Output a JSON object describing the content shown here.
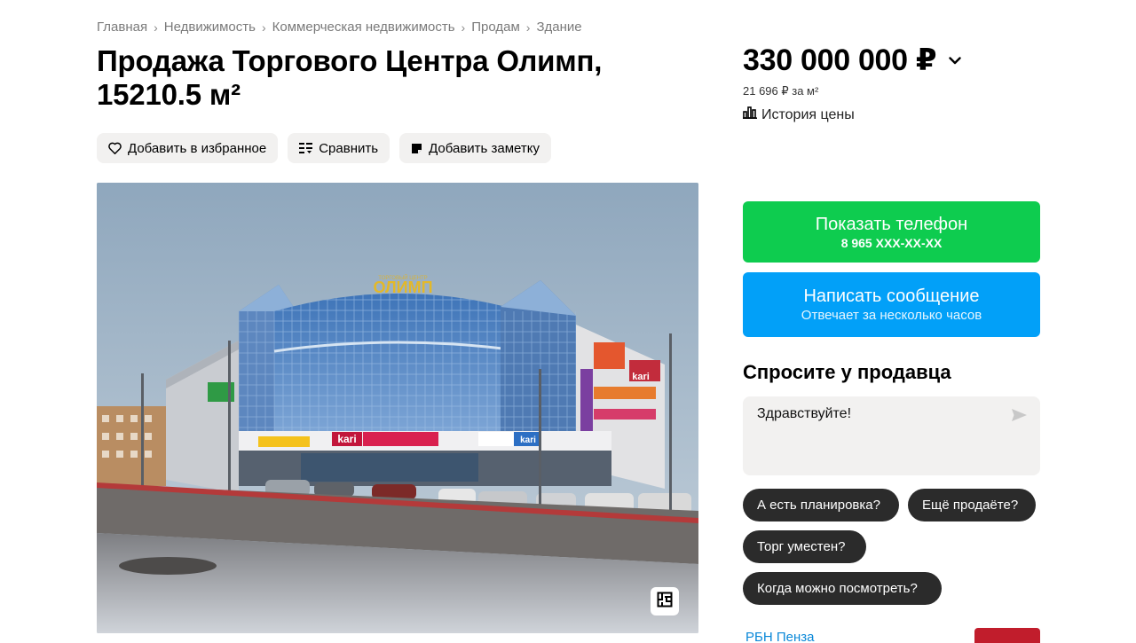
{
  "breadcrumb": [
    "Главная",
    "Недвижимость",
    "Коммерческая недвижимость",
    "Продам",
    "Здание"
  ],
  "title": "Продажа Торгового Центра Олимп, 15210.5 м²",
  "actions": {
    "favorite": "Добавить в избранное",
    "compare": "Сравнить",
    "note": "Добавить заметку"
  },
  "price": {
    "value": "330 000 000 ₽",
    "per_meter": "21 696 ₽ за м²",
    "history": "История цены"
  },
  "contact": {
    "phone_label": "Показать телефон",
    "phone_masked": "8 965 XXX-XX-XX",
    "message_label": "Написать сообщение",
    "message_sub": "Отвечает за несколько часов"
  },
  "ask": {
    "title": "Спросите у продавца",
    "message": "Здравствуйте!",
    "chips": [
      "А есть планировка?",
      "Ещё продаёте?",
      "Торг уместен?",
      "Когда можно посмотреть?"
    ]
  },
  "seller": {
    "name": "РБН Пенза"
  },
  "photo": {
    "sign_small": "ТОРГОВЫЙ ЦЕНТР",
    "sign_main": "ОЛИМП",
    "store_1": "kari",
    "store_2": "kari",
    "store_3": "kari"
  },
  "colors": {
    "phone_button": "#0ecc4f",
    "message_button": "#02a0f8",
    "chip_bg": "#2b2b2b",
    "seller_link": "#0a88d8"
  },
  "icons": {
    "favorite": "heart-icon",
    "compare": "compare-icon",
    "note": "note-icon",
    "price_dropdown": "chevron-down-icon",
    "history": "bar-chart-icon",
    "send": "send-icon",
    "gallery": "floor-plan-icon"
  }
}
